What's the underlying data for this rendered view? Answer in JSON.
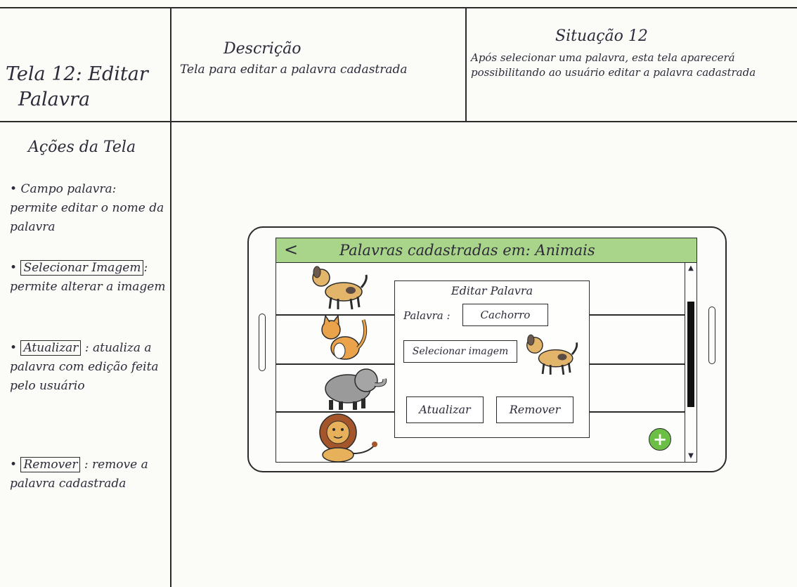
{
  "header": {
    "screen_name_line1": "Tela 12: Editar",
    "screen_name_line2": "Palavra",
    "description_title": "Descrição",
    "description_text": "Tela para editar a palavra cadastrada",
    "situation_title": "Situação 12",
    "situation_text": "Após selecionar uma palavra, esta tela aparecerá possibilitando ao usuário editar a palavra cadastrada"
  },
  "actions": {
    "title": "Ações da Tela",
    "items": [
      {
        "name": "",
        "text": "Campo palavra: permite editar o nome da palavra"
      },
      {
        "name": "Selecionar Imagem",
        "text": ": permite alterar a imagem"
      },
      {
        "name": "Atualizar",
        "text": ": atualiza a palavra com edição feita pelo usuário"
      },
      {
        "name": "Remover",
        "text": ": remove a palavra cadastrada"
      }
    ]
  },
  "mockup": {
    "back_label": "<",
    "title": "Palavras cadastradas em: Animais",
    "list_icons": [
      "dog-icon",
      "cat-icon",
      "elephant-icon",
      "lion-icon"
    ],
    "dialog": {
      "title": "Editar Palavra",
      "word_label": "Palavra :",
      "word_value": "Cachorro",
      "select_image_label": "Selecionar imagem",
      "update_label": "Atualizar",
      "remove_label": "Remover"
    },
    "fab_label": "+",
    "scroll_up": "▲",
    "scroll_down": "▼"
  },
  "colors": {
    "titlebar": "#a8d58a",
    "fab": "#6cbf45",
    "ink": "#2b2b2b"
  }
}
